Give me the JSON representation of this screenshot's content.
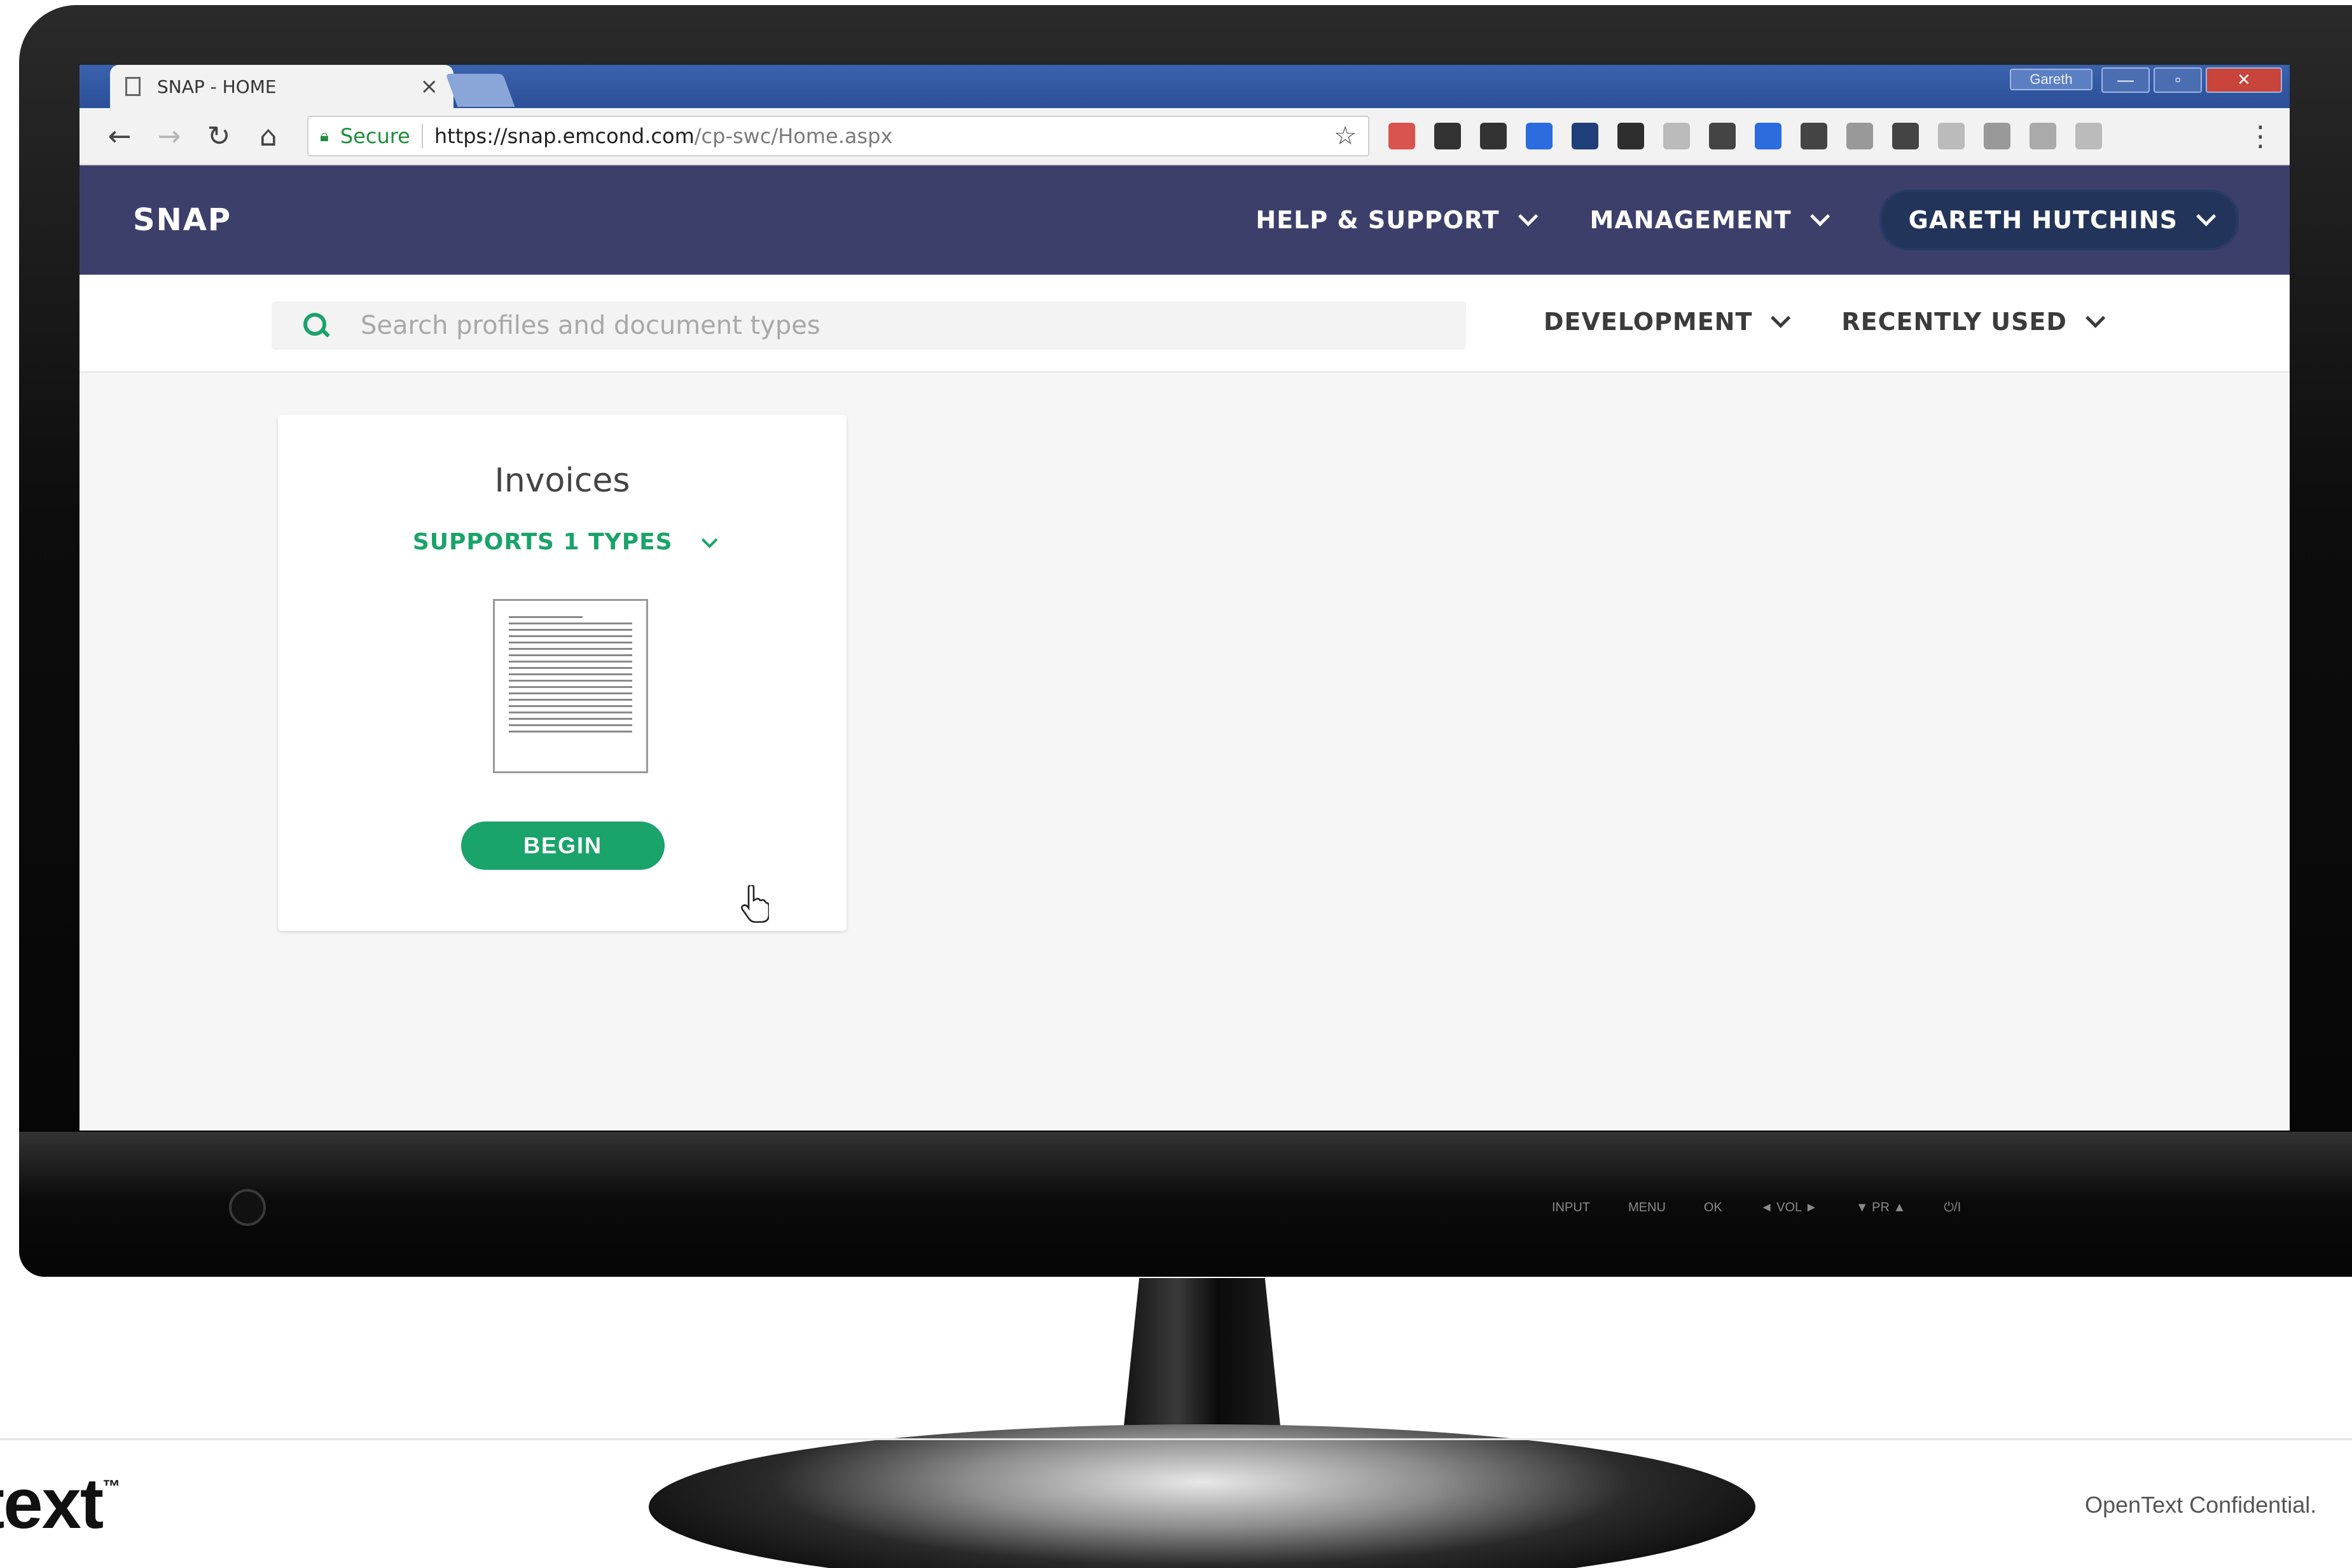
{
  "browser": {
    "tab_title": "SNAP - HOME",
    "tab_close": "×",
    "window_user": "Gareth",
    "window_buttons": {
      "minimize": "—",
      "maximize": "▫",
      "close": "✕"
    },
    "address": {
      "secure_label": "Secure",
      "url_host": "https://snap.emcond.com",
      "url_path": "/cp-swc/Home.aspx"
    },
    "extensions": [
      "google-plus-icon",
      "pocket-icon",
      "headphones-icon",
      "notes-icon",
      "feedly-icon",
      "evernote-icon",
      "webcam-icon",
      "camera-icon",
      "trello-icon",
      "mail-icon",
      "compass-icon",
      "cast-icon",
      "image-icon",
      "layout-icon",
      "code-icon",
      "pdf-icon"
    ]
  },
  "app": {
    "brand": "SNAP",
    "nav": {
      "help": "HELP & SUPPORT",
      "management": "MANAGEMENT",
      "user": "GARETH HUTCHINS"
    },
    "search": {
      "placeholder": "Search profiles and document types"
    },
    "sub_nav": {
      "development": "DEVELOPMENT",
      "recently_used": "RECENTLY USED"
    },
    "card": {
      "title": "Invoices",
      "types": "SUPPORTS 1 TYPES",
      "button": "BEGIN"
    },
    "colors": {
      "header": "#3d3f6b",
      "accent": "#1aa36a",
      "user_pill": "#22345a"
    }
  },
  "monitor": {
    "controls": [
      "INPUT",
      "MENU",
      "OK",
      "◄ VOL ►",
      "▼ PR ▲",
      "⏻/I"
    ]
  },
  "slide": {
    "logo_text": "text",
    "logo_mark": "™",
    "confidential": "OpenText Confidential."
  }
}
